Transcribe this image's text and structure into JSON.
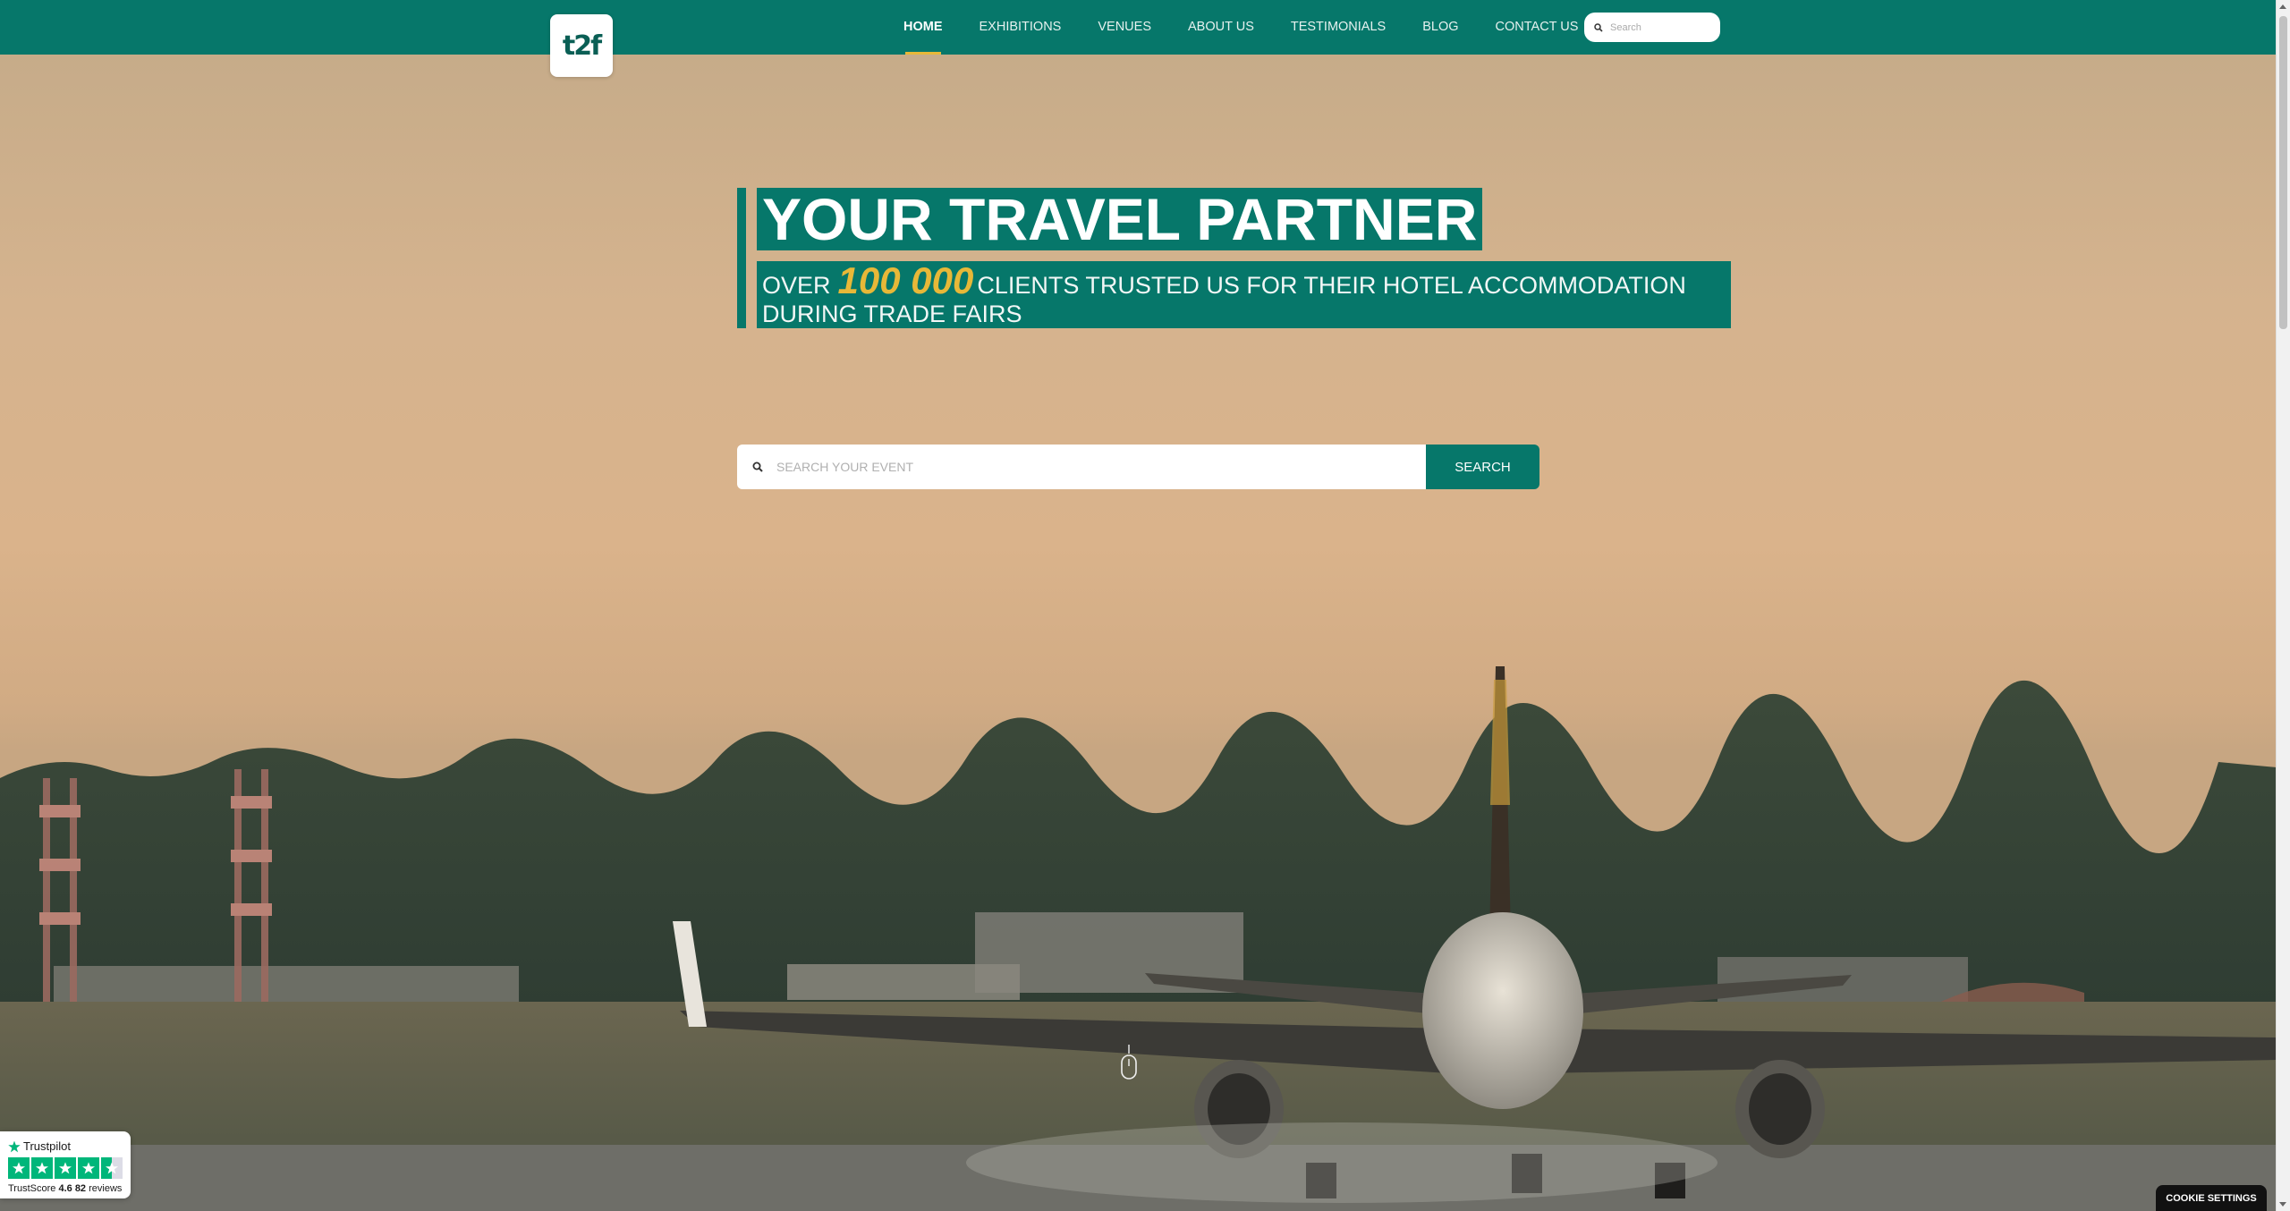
{
  "nav": {
    "logo_text": "t2f",
    "items": [
      {
        "label": "HOME",
        "active": true
      },
      {
        "label": "EXHIBITIONS",
        "active": false
      },
      {
        "label": "VENUES",
        "active": false
      },
      {
        "label": "ABOUT US",
        "active": false
      },
      {
        "label": "TESTIMONIALS",
        "active": false
      },
      {
        "label": "BLOG",
        "active": false
      },
      {
        "label": "CONTACT US",
        "active": false
      }
    ],
    "search_placeholder": "Search",
    "active_underline_color": "#e7b838"
  },
  "hero": {
    "title": "YOUR TRAVEL PARTNER",
    "subtitle_prefix": "OVER",
    "subtitle_highlight": "100 000",
    "subtitle_suffix": "CLIENTS TRUSTED US FOR THEIR HOTEL ACCOMMODATION DURING TRADE FAIRS",
    "accent_color": "#06776a",
    "highlight_color": "#e7b838"
  },
  "event_search": {
    "placeholder": "SEARCH YOUR EVENT",
    "button_label": "SEARCH",
    "icon": "search-icon"
  },
  "scroll_indicator": {
    "icon": "mouse-scroll-icon"
  },
  "trustpilot": {
    "brand": "Trustpilot",
    "score_label": "TrustScore",
    "score": "4.6",
    "reviews_count": "82",
    "reviews_label": "reviews",
    "rating": 4.5,
    "star_color": "#00b67a"
  },
  "cookie": {
    "label": "COOKIE SETTINGS"
  },
  "colors": {
    "primary": "#06776a",
    "accent": "#e7b838"
  }
}
